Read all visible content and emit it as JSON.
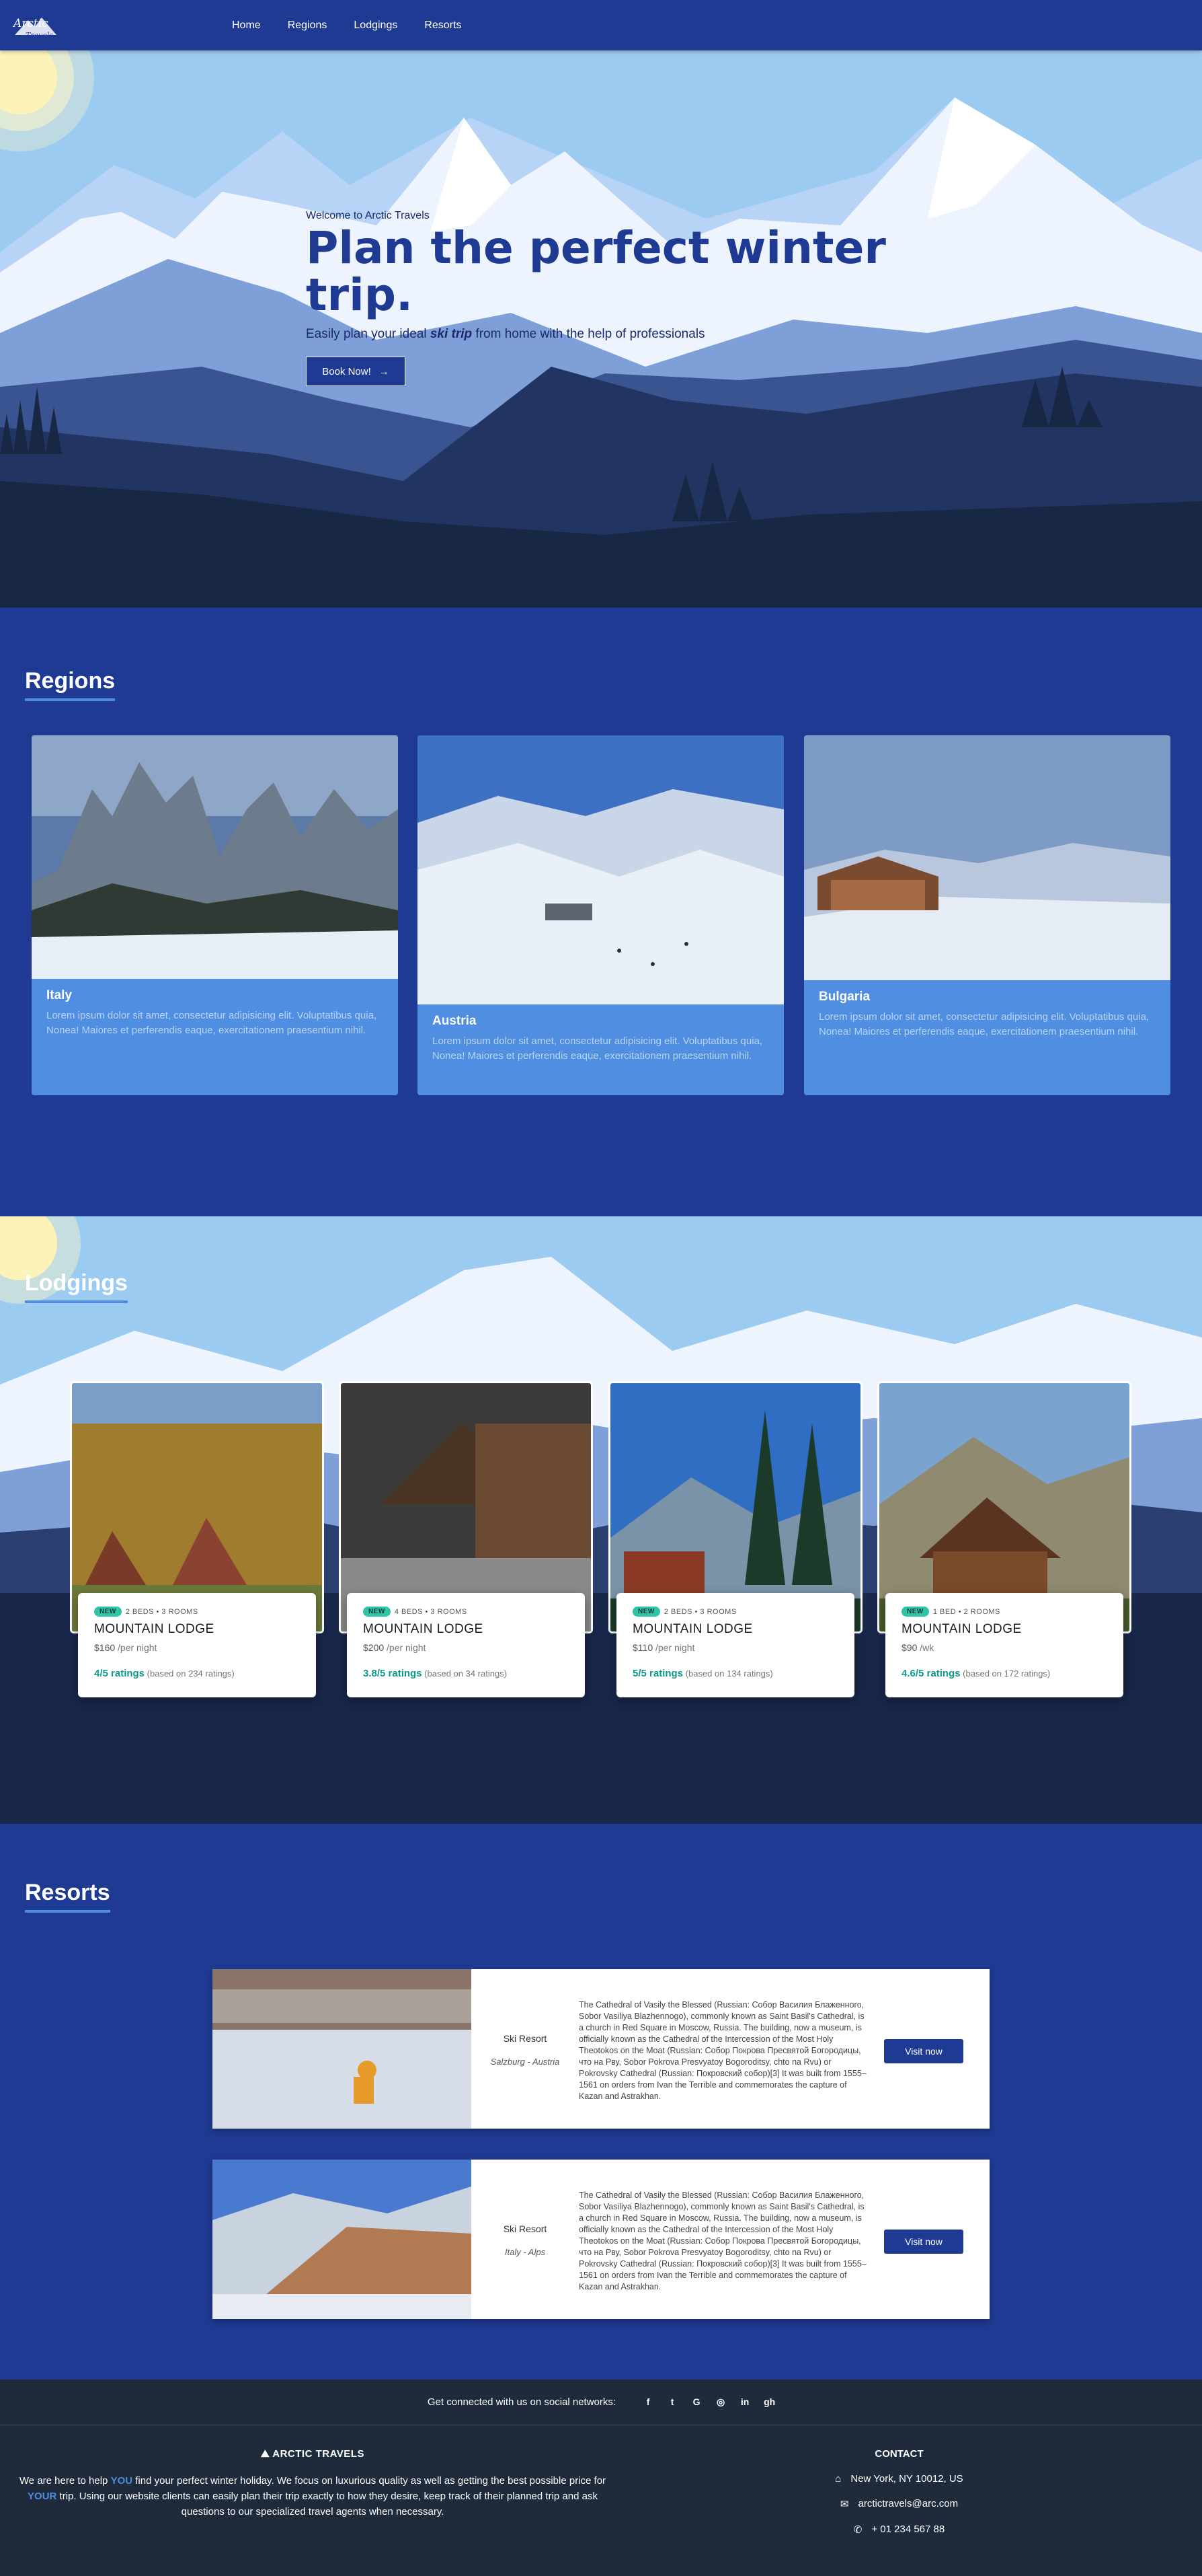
{
  "nav": {
    "logo": "Arctic Travels",
    "links": [
      "Home",
      "Regions",
      "Lodgings",
      "Resorts"
    ]
  },
  "hero": {
    "welcome": "Welcome to Arctic Travels",
    "title": "Plan the perfect winter trip.",
    "sub_before": "Easily plan your ideal ",
    "sub_em": "ski trip",
    "sub_after": " from home with the help of professionals",
    "button": "Book Now!"
  },
  "regions": {
    "title": "Regions",
    "items": [
      {
        "name": "Italy",
        "desc": "Lorem ipsum dolor sit amet, consectetur adipisicing elit. Voluptatibus quia, Nonea! Maiores et perferendis eaque, exercitationem praesentium nihil."
      },
      {
        "name": "Austria",
        "desc": "Lorem ipsum dolor sit amet, consectetur adipisicing elit. Voluptatibus quia, Nonea! Maiores et perferendis eaque, exercitationem praesentium nihil."
      },
      {
        "name": "Bulgaria",
        "desc": "Lorem ipsum dolor sit amet, consectetur adipisicing elit. Voluptatibus quia, Nonea! Maiores et perferendis eaque, exercitationem praesentium nihil."
      }
    ]
  },
  "lodgings": {
    "title": "Lodgings",
    "items": [
      {
        "badge": "NEW",
        "meta": "2 BEDS • 3 ROOMS",
        "name": "MOUNTAIN LODGE",
        "price": "$160",
        "unit": "/per night",
        "score": "4/5 ratings",
        "based": "(based on 234 ratings)"
      },
      {
        "badge": "NEW",
        "meta": "4 BEDS • 3 ROOMS",
        "name": "MOUNTAIN LODGE",
        "price": "$200",
        "unit": "/per night",
        "score": "3.8/5 ratings",
        "based": "(based on 34 ratings)"
      },
      {
        "badge": "NEW",
        "meta": "2 BEDS • 3 ROOMS",
        "name": "MOUNTAIN LODGE",
        "price": "$110",
        "unit": "/per night",
        "score": "5/5 ratings",
        "based": "(based on 134 ratings)"
      },
      {
        "badge": "NEW",
        "meta": "1 BED • 2 ROOMS",
        "name": "MOUNTAIN LODGE",
        "price": "$90",
        "unit": "/wk",
        "score": "4.6/5 ratings",
        "based": "(based on 172 ratings)"
      }
    ]
  },
  "resorts": {
    "title": "Resorts",
    "items": [
      {
        "type": "Ski Resort",
        "location": "Salzburg - Austria",
        "desc": "The Cathedral of Vasily the Blessed (Russian: Собор Василия Блаженного, Sobor Vasiliya Blazhennogo), commonly known as Saint Basil's Cathedral, is a church in Red Square in Moscow, Russia. The building, now a museum, is officially known as the Cathedral of the Intercession of the Most Holy Theotokos on the Moat (Russian: Собор Покрова Пресвятой Богородицы, что на Рву, Sobor Pokrova Presvyatoy Bogoroditsy, chto na Rvu) or Pokrovsky Cathedral (Russian: Покровский собор)[3] It was built from 1555–1561 on orders from Ivan the Terrible and commemorates the capture of Kazan and Astrakhan.",
        "button": "Visit now"
      },
      {
        "type": "Ski Resort",
        "location": "Italy - Alps",
        "desc": "The Cathedral of Vasily the Blessed (Russian: Собор Василия Блаженного, Sobor Vasiliya Blazhennogo), commonly known as Saint Basil's Cathedral, is a church in Red Square in Moscow, Russia. The building, now a museum, is officially known as the Cathedral of the Intercession of the Most Holy Theotokos on the Moat (Russian: Собор Покрова Пресвятой Богородицы, что на Рву, Sobor Pokrova Presvyatoy Bogoroditsy, chto na Rvu) or Pokrovsky Cathedral (Russian: Покровский собор)[3] It was built from 1555–1561 on orders from Ivan the Terrible and commemorates the capture of Kazan and Astrakhan.",
        "button": "Visit now"
      }
    ]
  },
  "footer": {
    "social_label": "Get connected with us on social networks:",
    "social_icons": [
      "f",
      "t",
      "G",
      "◎",
      "in",
      "gh"
    ],
    "about_title": "ARCTIC TRAVELS",
    "about_p1": "We are here to help ",
    "about_you": "YOU",
    "about_p2": " find your perfect winter holiday. We focus on luxurious quality as well as getting the best possible price for ",
    "about_your": "YOUR",
    "about_p3": " trip. Using our website clients can easily plan their trip exactly to how they desire, keep track of their planned trip and ask questions to our specialized travel agents when necessary.",
    "contact_title": "CONTACT",
    "address": "New York, NY 10012, US",
    "email": "arctictravels@arc.com",
    "phone": "+ 01 234 567 88"
  },
  "colors": {
    "navy": "#1f3a93",
    "sky": "#9ccbf2",
    "accent": "#4d8ce0",
    "footer": "#1f2a3a",
    "rating": "#0f9a8a"
  }
}
